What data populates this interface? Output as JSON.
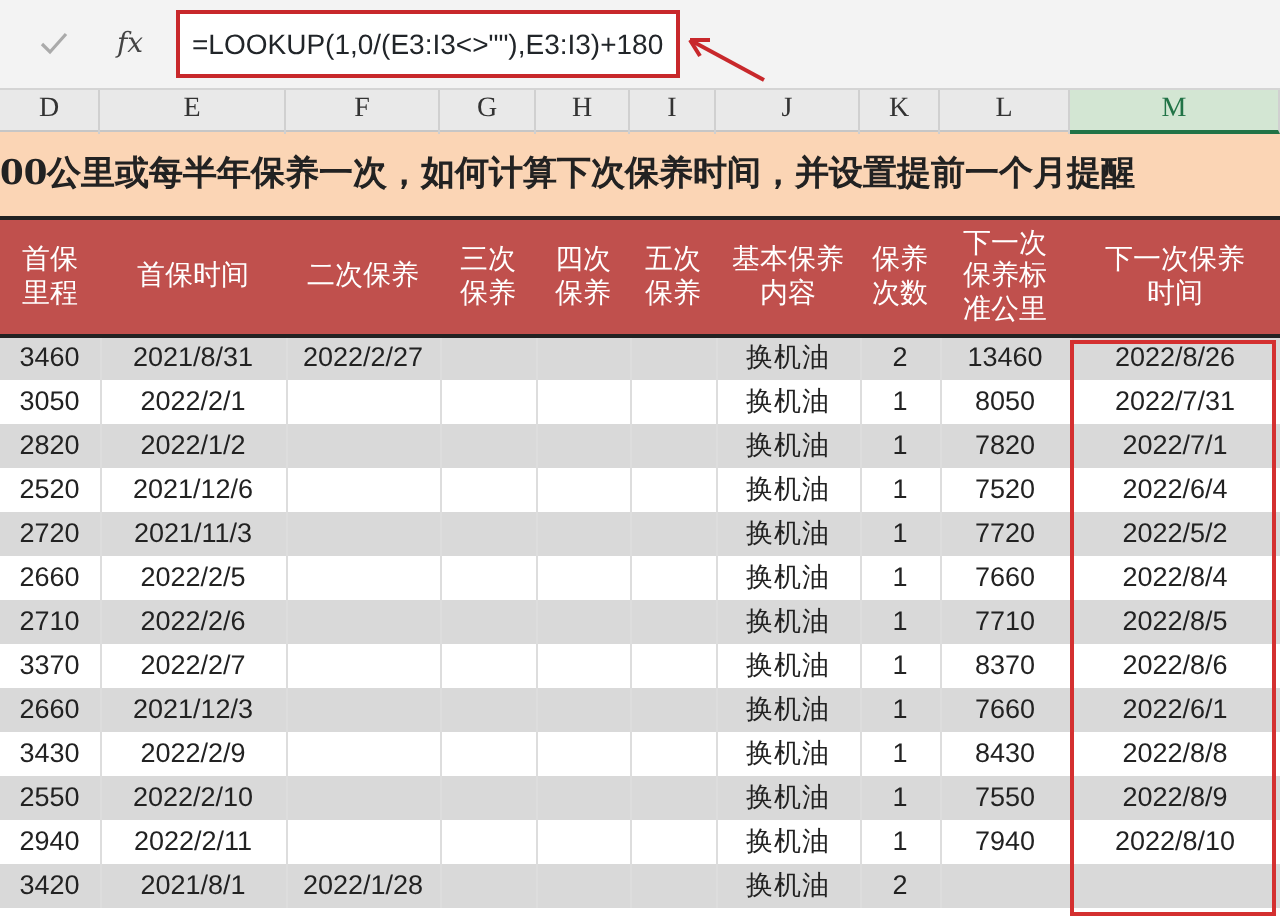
{
  "formula_bar": {
    "fx_label": "fx",
    "formula": "=LOOKUP(1,0/(E3:I3<>\"\"),E3:I3)+180"
  },
  "column_headers": [
    {
      "label": "D",
      "selected": false
    },
    {
      "label": "E",
      "selected": false
    },
    {
      "label": "F",
      "selected": false
    },
    {
      "label": "G",
      "selected": false
    },
    {
      "label": "H",
      "selected": false
    },
    {
      "label": "I",
      "selected": false
    },
    {
      "label": "J",
      "selected": false
    },
    {
      "label": "K",
      "selected": false
    },
    {
      "label": "L",
      "selected": false
    },
    {
      "label": "M",
      "selected": true
    }
  ],
  "title": "00公里或每半年保养一次，如何计算下次保养时间，并设置提前一个月提醒",
  "table": {
    "columns": [
      "首保里程",
      "首保时间",
      "二次保养",
      "三次保养",
      "四次保养",
      "五次保养",
      "基本保养内容",
      "保养次数",
      "下一次保养标准公里",
      "下一次保养时间"
    ],
    "rows": [
      [
        "3460",
        "2021/8/31",
        "2022/2/27",
        null,
        null,
        null,
        "换机油",
        "2",
        "13460",
        "2022/8/26"
      ],
      [
        "3050",
        "2022/2/1",
        null,
        null,
        null,
        null,
        "换机油",
        "1",
        "8050",
        "2022/7/31"
      ],
      [
        "2820",
        "2022/1/2",
        null,
        null,
        null,
        null,
        "换机油",
        "1",
        "7820",
        "2022/7/1"
      ],
      [
        "2520",
        "2021/12/6",
        null,
        null,
        null,
        null,
        "换机油",
        "1",
        "7520",
        "2022/6/4"
      ],
      [
        "2720",
        "2021/11/3",
        null,
        null,
        null,
        null,
        "换机油",
        "1",
        "7720",
        "2022/5/2"
      ],
      [
        "2660",
        "2022/2/5",
        null,
        null,
        null,
        null,
        "换机油",
        "1",
        "7660",
        "2022/8/4"
      ],
      [
        "2710",
        "2022/2/6",
        null,
        null,
        null,
        null,
        "换机油",
        "1",
        "7710",
        "2022/8/5"
      ],
      [
        "3370",
        "2022/2/7",
        null,
        null,
        null,
        null,
        "换机油",
        "1",
        "8370",
        "2022/8/6"
      ],
      [
        "2660",
        "2021/12/3",
        null,
        null,
        null,
        null,
        "换机油",
        "1",
        "7660",
        "2022/6/1"
      ],
      [
        "3430",
        "2022/2/9",
        null,
        null,
        null,
        null,
        "换机油",
        "1",
        "8430",
        "2022/8/8"
      ],
      [
        "2550",
        "2022/2/10",
        null,
        null,
        null,
        null,
        "换机油",
        "1",
        "7550",
        "2022/8/9"
      ],
      [
        "2940",
        "2022/2/11",
        null,
        null,
        null,
        null,
        "换机油",
        "1",
        "7940",
        "2022/8/10"
      ],
      [
        "3420",
        "2021/8/1",
        "2022/1/28",
        null,
        null,
        null,
        "换机油",
        "2",
        null,
        null
      ]
    ]
  }
}
